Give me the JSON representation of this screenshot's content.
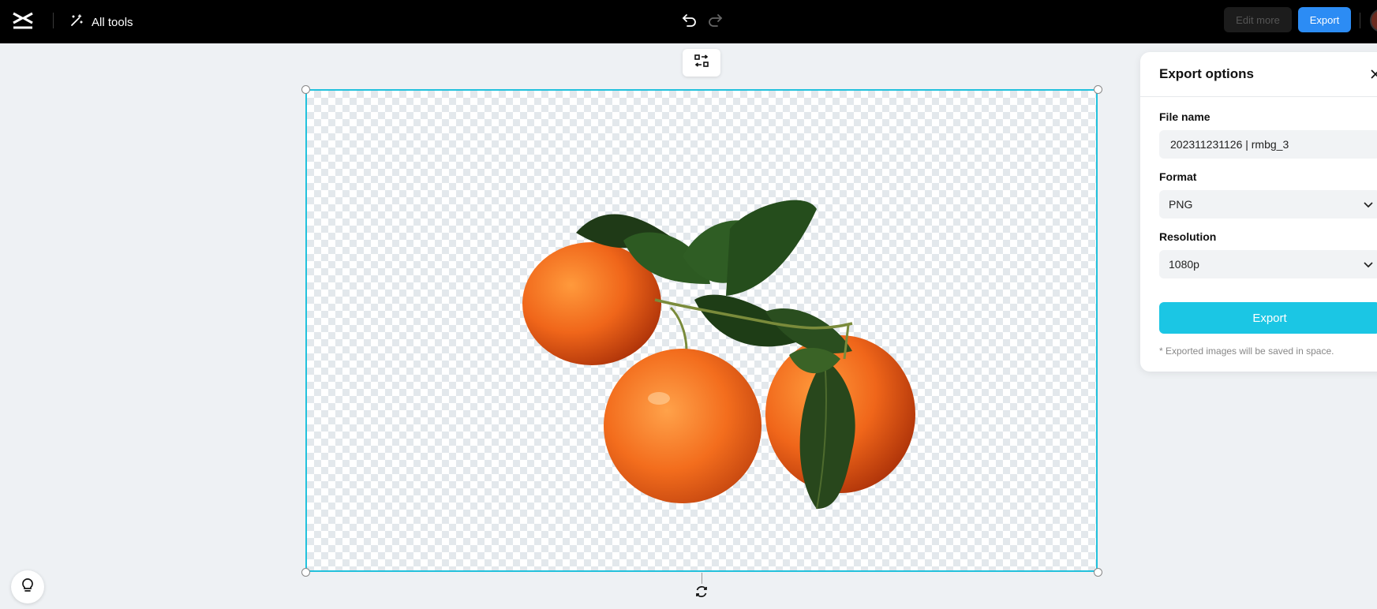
{
  "header": {
    "all_tools_label": "All tools",
    "edit_more_label": "Edit more",
    "export_label": "Export"
  },
  "export_panel": {
    "title": "Export options",
    "file_name_label": "File name",
    "file_name_value": "202311231126 | rmbg_3",
    "format_label": "Format",
    "format_value": "PNG",
    "resolution_label": "Resolution",
    "resolution_value": "1080p",
    "export_button_label": "Export",
    "note": "* Exported images will be saved in space."
  },
  "icons": {
    "logo": "capcut-logo-icon",
    "all_tools": "magic-wand-icon",
    "undo": "undo-icon",
    "redo": "redo-icon",
    "swap": "swap-icon",
    "rotate": "rotate-icon",
    "hint": "lightbulb-icon",
    "close": "close-icon",
    "chevron": "chevron-down-icon"
  },
  "colors": {
    "accent": "#1bc6e4",
    "top_export": "#2c8cf4",
    "selection_border": "#22c1dc"
  }
}
